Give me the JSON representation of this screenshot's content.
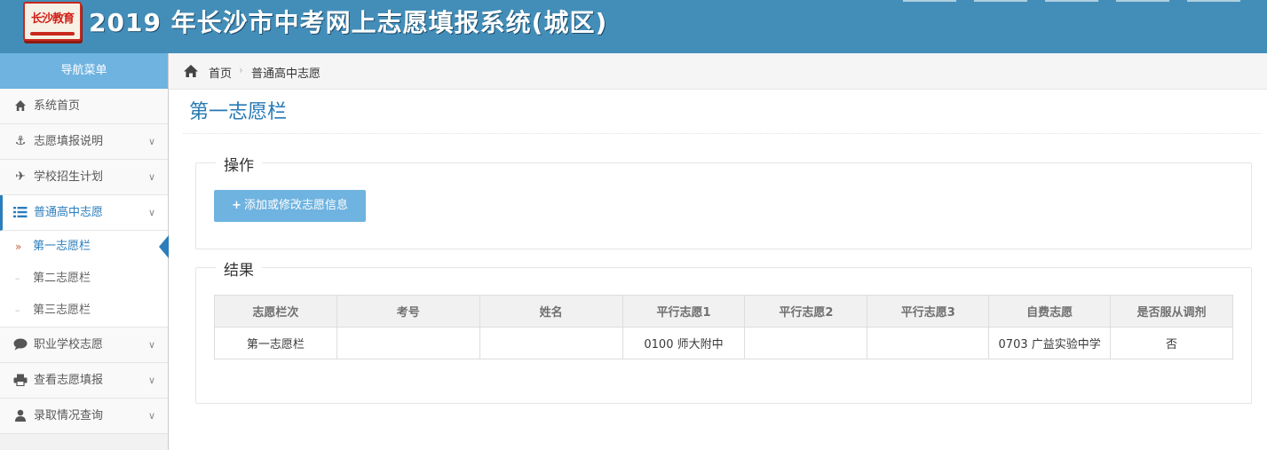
{
  "header": {
    "logo_text": "长沙教育",
    "title": "2019 年长沙市中考网上志愿填报系统(城区)"
  },
  "sidebar": {
    "heading": "导航菜单",
    "items": [
      {
        "label": "系统首页",
        "icon": "home-icon"
      },
      {
        "label": "志愿填报说明",
        "icon": "anchor-icon"
      },
      {
        "label": "学校招生计划",
        "icon": "plane-icon"
      },
      {
        "label": "普通高中志愿",
        "icon": "list-icon"
      },
      {
        "label": "职业学校志愿",
        "icon": "comment-icon"
      },
      {
        "label": "查看志愿填报",
        "icon": "print-icon"
      },
      {
        "label": "录取情况查询",
        "icon": "user-icon"
      }
    ],
    "subitems": [
      {
        "label": "第一志愿栏"
      },
      {
        "label": "第二志愿栏"
      },
      {
        "label": "第三志愿栏"
      }
    ]
  },
  "breadcrumb": {
    "home": "首页",
    "current": "普通高中志愿"
  },
  "main": {
    "title": "第一志愿栏",
    "ops_legend": "操作",
    "add_button": "添加或修改志愿信息",
    "result_legend": "结果"
  },
  "table": {
    "headers": [
      "志愿栏次",
      "考号",
      "姓名",
      "平行志愿1",
      "平行志愿2",
      "平行志愿3",
      "自费志愿",
      "是否服从调剂"
    ],
    "rows": [
      [
        "第一志愿栏",
        "",
        "",
        "0100 师大附中",
        "",
        "",
        "0703 广益实验中学",
        "否"
      ]
    ]
  },
  "colors": {
    "header_bg": "#438eb9",
    "accent": "#2b7dbc",
    "button_bg": "#6fb3e0"
  }
}
